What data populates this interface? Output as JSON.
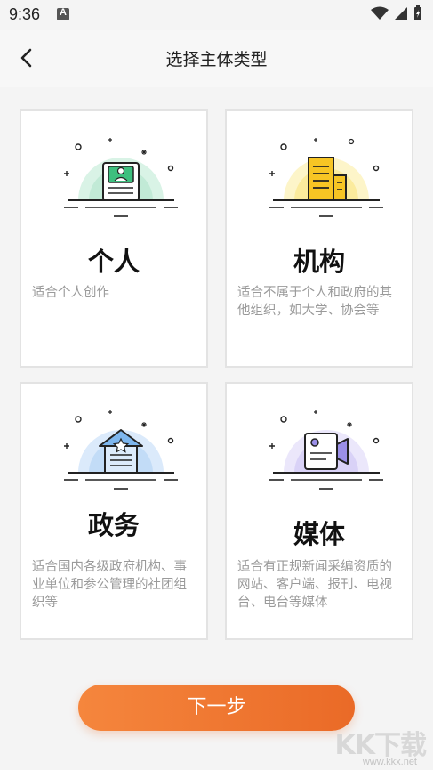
{
  "status": {
    "time": "9:36"
  },
  "header": {
    "title": "选择主体类型"
  },
  "cards": [
    {
      "name": "个人",
      "desc": "适合个人创作",
      "icon": "person-id-card-icon",
      "accent": "#3dbf7e"
    },
    {
      "name": "机构",
      "desc": "适合不属于个人和政府的其他组织，如大学、协会等",
      "icon": "building-icon",
      "accent": "#f7c524"
    },
    {
      "name": "政务",
      "desc": "适合国内各级政府机构、事业单位和参公管理的社团组织等",
      "icon": "government-star-building-icon",
      "accent": "#5aa3e8"
    },
    {
      "name": "媒体",
      "desc": "适合有正规新闻采编资质的网站、客户端、报刊、电视台、电台等媒体",
      "icon": "video-camera-icon",
      "accent": "#9b8fe8"
    }
  ],
  "footer": {
    "next_label": "下一步"
  },
  "watermark": {
    "text": "KK下载",
    "url": "www.kkx.net"
  },
  "colors": {
    "button_start": "#f5863d",
    "button_end": "#ea6a27",
    "text_muted": "#9a9a9a"
  }
}
